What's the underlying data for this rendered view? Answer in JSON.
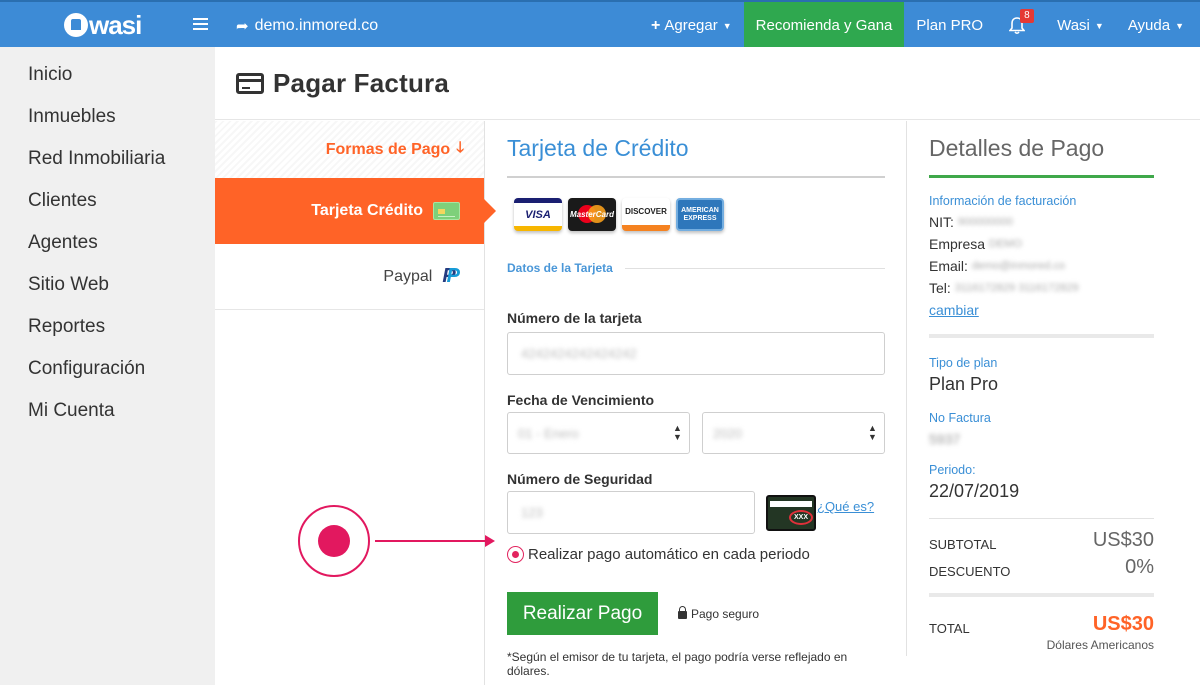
{
  "topbar": {
    "logo": "wasi",
    "domain": "demo.inmored.co",
    "add_label": "Agregar",
    "recommend_label": "Recomienda y Gana",
    "plan_label": "Plan PRO",
    "notifications_count": "8",
    "user_label": "Wasi",
    "help_label": "Ayuda",
    "colors": {
      "bar": "#3d8bd6",
      "recommend": "#2fa84f"
    }
  },
  "sidebar": {
    "items": [
      {
        "label": "Inicio"
      },
      {
        "label": "Inmuebles"
      },
      {
        "label": "Red Inmobiliaria"
      },
      {
        "label": "Clientes"
      },
      {
        "label": "Agentes"
      },
      {
        "label": "Sitio Web"
      },
      {
        "label": "Reportes"
      },
      {
        "label": "Configuración"
      },
      {
        "label": "Mi Cuenta"
      }
    ]
  },
  "page": {
    "title": "Pagar Factura",
    "icon": "credit-card-icon"
  },
  "methods": {
    "header": "Formas de Pago",
    "items": [
      {
        "label": "Tarjeta Crédito",
        "active": true,
        "icon": "credit-card-icon"
      },
      {
        "label": "Paypal",
        "active": false,
        "icon": "paypal-icon"
      }
    ],
    "accent": "#ff6327"
  },
  "form": {
    "title": "Tarjeta de Crédito",
    "card_logos": [
      {
        "name": "VISA"
      },
      {
        "name": "MasterCard"
      },
      {
        "name": "DISCOVER"
      },
      {
        "name": "AMERICAN EXPRESS"
      }
    ],
    "section_label": "Datos de la Tarjeta",
    "card_number_label": "Número de la tarjeta",
    "card_number_value": "4242424242424242",
    "expiry_label": "Fecha de Vencimiento",
    "expiry_month": "01 - Enero",
    "expiry_year": "2020",
    "cvv_label": "Número de Seguridad",
    "cvv_value": "123",
    "cvv_badge": "XXX",
    "cvv_help": "¿Qué es?",
    "autopay_label": "Realizar pago automático en cada periodo",
    "autopay_checked": true,
    "pay_button": "Realizar Pago",
    "secure_label": "Pago seguro",
    "note": "*Según el emisor de tu tarjeta, el pago podría verse reflejado en dólares."
  },
  "details": {
    "title": "Detalles de Pago",
    "billing_label": "Información de facturación",
    "nit_key": "NIT:",
    "nit_value": "900000000",
    "company_key": "Empresa",
    "company_value": "DEMO",
    "email_key": "Email:",
    "email_value": "demo@inmored.co",
    "phone_key": "Tel:",
    "phone_value": "3116172829 3116172829",
    "change_link": "cambiar",
    "plan_type_label": "Tipo de plan",
    "plan_type_value": "Plan Pro",
    "invoice_label": "No Factura",
    "invoice_value": "5937",
    "period_label": "Periodo:",
    "period_value": "22/07/2019",
    "subtotal_label": "SUBTOTAL",
    "subtotal_value": "US$30",
    "discount_label": "DESCUENTO",
    "discount_value": "0%",
    "total_label": "TOTAL",
    "total_value": "US$30",
    "currency_label": "Dólares Americanos"
  }
}
